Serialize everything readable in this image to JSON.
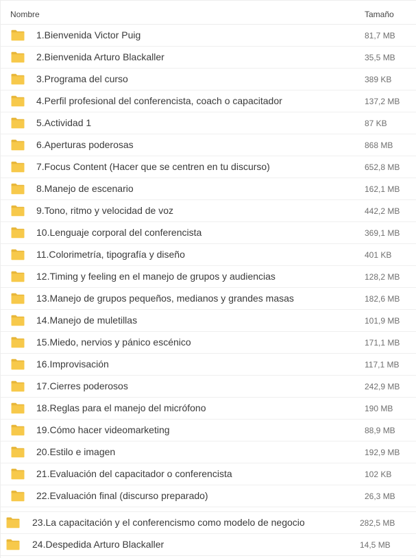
{
  "header": {
    "name_label": "Nombre",
    "size_label": "Tamaño"
  },
  "colors": {
    "folder_body": "#f7c94b",
    "folder_tab": "#e8b73a"
  },
  "items": [
    {
      "name": "1.Bienvenida Victor Puig",
      "size": "81,7 MB",
      "icon": "folder-icon"
    },
    {
      "name": "2.Bienvenida Arturo Blackaller",
      "size": "35,5 MB",
      "icon": "folder-icon"
    },
    {
      "name": "3.Programa del curso",
      "size": "389 KB",
      "icon": "folder-icon"
    },
    {
      "name": "4.Perfil profesional del conferencista, coach o capacitador",
      "size": "137,2 MB",
      "icon": "folder-icon"
    },
    {
      "name": "5.Actividad 1",
      "size": "87 KB",
      "icon": "folder-icon"
    },
    {
      "name": "6.Aperturas poderosas",
      "size": "868 MB",
      "icon": "folder-icon"
    },
    {
      "name": "7.Focus Content (Hacer que se centren en tu discurso)",
      "size": "652,8 MB",
      "icon": "folder-icon"
    },
    {
      "name": "8.Manejo de escenario",
      "size": "162,1 MB",
      "icon": "folder-icon"
    },
    {
      "name": "9.Tono, ritmo y velocidad de voz",
      "size": "442,2 MB",
      "icon": "folder-icon"
    },
    {
      "name": "10.Lenguaje corporal del conferencista",
      "size": "369,1 MB",
      "icon": "folder-icon"
    },
    {
      "name": "11.Colorimetría, tipografía y diseño",
      "size": "401 KB",
      "icon": "folder-icon"
    },
    {
      "name": "12.Timing y feeling en el manejo de grupos y audiencias",
      "size": "128,2 MB",
      "icon": "folder-icon"
    },
    {
      "name": "13.Manejo de grupos pequeños, medianos y grandes masas",
      "size": "182,6 MB",
      "icon": "folder-icon"
    },
    {
      "name": "14.Manejo de muletillas",
      "size": "101,9 MB",
      "icon": "folder-icon"
    },
    {
      "name": "15.Miedo, nervios y pánico escénico",
      "size": "171,1 MB",
      "icon": "folder-icon"
    },
    {
      "name": "16.Improvisación",
      "size": "117,1 MB",
      "icon": "folder-icon"
    },
    {
      "name": "17.Cierres poderosos",
      "size": "242,9 MB",
      "icon": "folder-icon"
    },
    {
      "name": "18.Reglas para el manejo del micrófono",
      "size": "190 MB",
      "icon": "folder-icon"
    },
    {
      "name": "19.Cómo hacer videomarketing",
      "size": "88,9 MB",
      "icon": "folder-icon"
    },
    {
      "name": "20.Estilo e imagen",
      "size": "192,9 MB",
      "icon": "folder-icon"
    },
    {
      "name": "21.Evaluación del capacitador o conferencista",
      "size": "102 KB",
      "icon": "folder-icon"
    },
    {
      "name": "22.Evaluación final (discurso preparado)",
      "size": "26,3 MB",
      "icon": "folder-icon"
    }
  ],
  "items_extra": [
    {
      "name": "23.La capacitación y el conferencismo como modelo de negocio",
      "size": "282,5 MB",
      "icon": "folder-icon"
    },
    {
      "name": "24.Despedida Arturo Blackaller",
      "size": "14,5 MB",
      "icon": "folder-icon"
    }
  ]
}
